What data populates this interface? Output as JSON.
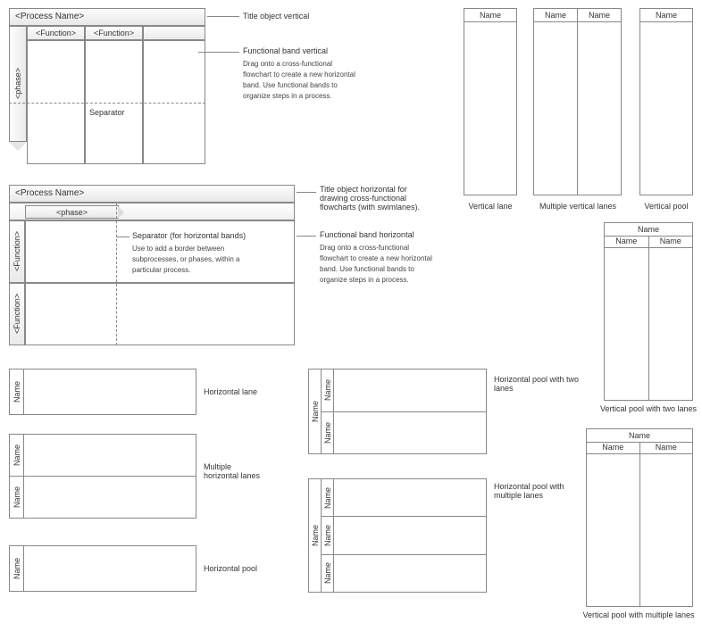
{
  "flow_v": {
    "title": "<Process Name>",
    "phase": "<phase>",
    "func1": "<Function>",
    "func2": "<Function>",
    "sep": "Separator"
  },
  "flow_h": {
    "title": "<Process Name>",
    "phase": "<phase>",
    "func1": "<Function>",
    "func2": "<Function>",
    "sep_title": "Separator (for horizontal bands)",
    "sep_desc": "Use to add a border between subprocesses, or phases, within a particular process."
  },
  "ann": {
    "title_v": "Title object vertical",
    "fb_v_title": "Functional band vertical",
    "fb_v_desc": "Drag onto a cross-functional flowchart to create a new horizontal band. Use functional bands to organize steps in a process.",
    "title_h": "Title object horizontal for drawing cross-functional flowcharts (with swimlanes).",
    "fb_h_title": "Functional band horizontal",
    "fb_h_desc": "Drag onto a cross-functional flowchart to create a new horizontal band. Use functional bands to organize steps in a process."
  },
  "labels": {
    "name": "Name",
    "vertical_lane": "Vertical lane",
    "multiple_vertical_lanes": "Multiple vertical lanes",
    "vertical_pool": "Vertical pool",
    "vertical_pool_two": "Vertical pool with two lanes",
    "vertical_pool_multi": "Vertical pool with multiple lanes",
    "horizontal_lane": "Horizontal lane",
    "multiple_horizontal_lanes": "Multiple horizontal lanes",
    "horizontal_pool": "Horizontal pool",
    "horizontal_pool_two": "Horizontal pool with two lanes",
    "horizontal_pool_multi": "Horizontal pool with multiple lanes"
  }
}
